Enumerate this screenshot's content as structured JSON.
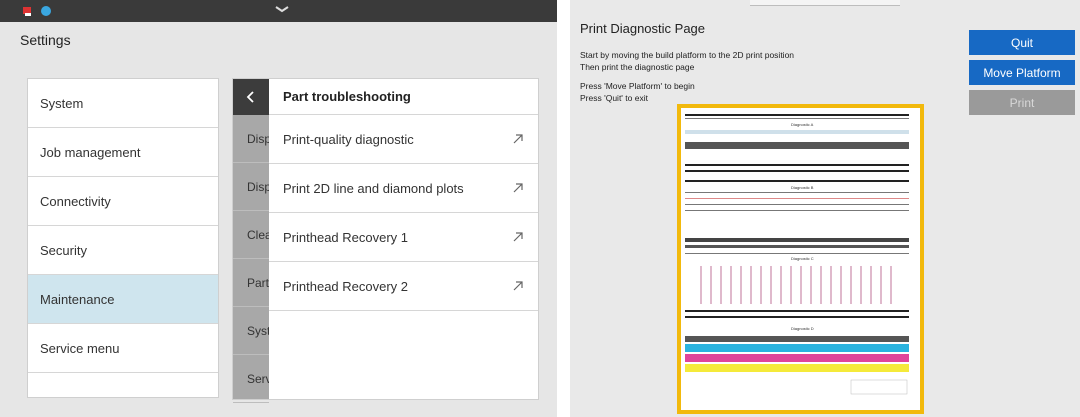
{
  "left": {
    "title": "Settings",
    "menu": [
      {
        "label": "System",
        "active": false
      },
      {
        "label": "Job management",
        "active": false
      },
      {
        "label": "Connectivity",
        "active": false
      },
      {
        "label": "Security",
        "active": false
      },
      {
        "label": "Maintenance",
        "active": true
      },
      {
        "label": "Service menu",
        "active": false
      }
    ],
    "collapsed_items": [
      "Disp",
      "Disp",
      "Clea",
      "Part",
      "Syst",
      "Serv"
    ],
    "submenu": {
      "title": "Part troubleshooting",
      "items": [
        {
          "label": "Print-quality diagnostic"
        },
        {
          "label": "Print 2D line and diamond plots"
        },
        {
          "label": "Printhead Recovery 1"
        },
        {
          "label": "Printhead Recovery 2"
        }
      ]
    }
  },
  "right": {
    "title": "Print Diagnostic Page",
    "instructions": [
      "Start by moving the build platform to the 2D print position",
      "Then print the diagnostic page",
      "Press 'Move Platform' to begin",
      "Press 'Quit' to exit"
    ],
    "buttons": {
      "quit": "Quit",
      "move": "Move Platform",
      "print": "Print"
    },
    "preview_labels": [
      "Diagnostic A",
      "Diagnostic B",
      "Diagnostic C",
      "Diagnostic D"
    ],
    "colors": {
      "accent": "#1769c4",
      "highlight": "#f2b90c",
      "selected": "#cfe5ee"
    }
  }
}
